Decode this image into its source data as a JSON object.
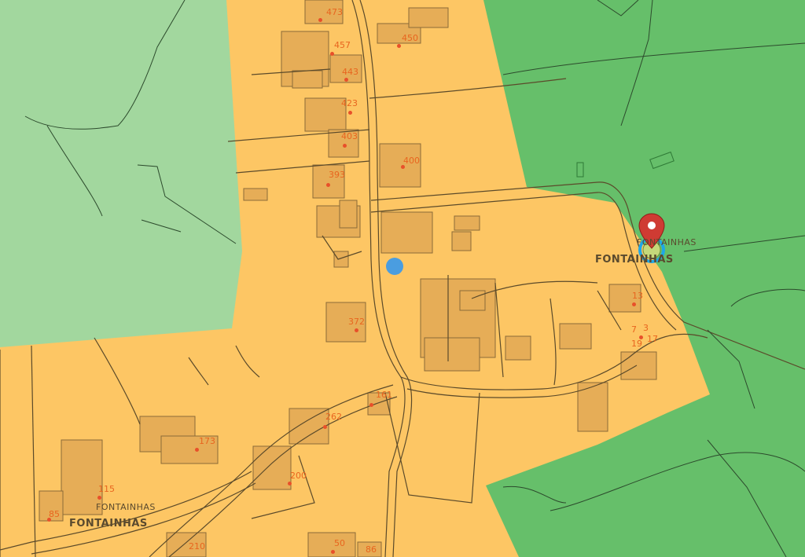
{
  "map": {
    "place_labels": {
      "east_small": "FONTAINHAS",
      "east_large": "FONTAINHAS",
      "southwest_small": "FONTAINHAS",
      "southwest_large": "FONTAINHAS"
    },
    "address_numbers": [
      "473",
      "450",
      "457",
      "443",
      "423",
      "403",
      "400",
      "393",
      "372",
      "13",
      "7",
      "3",
      "19",
      "17",
      "161",
      "262",
      "173",
      "115",
      "85",
      "200",
      "210",
      "50",
      "86"
    ],
    "colors": {
      "built_zone": "#fdc664",
      "forest_light": "#a2d79e",
      "forest_dark": "#66bf6a",
      "building": "#e6ad57",
      "outline": "#5b4a2a",
      "address_text": "#e8651f",
      "marker_red": "#cf3b33",
      "location_ring": "#1ea7e8",
      "current_location": "#4a9de0"
    },
    "icons": {
      "pin": "map-pin-icon",
      "current_location": "current-location-icon",
      "target": "target-ring-icon"
    }
  }
}
